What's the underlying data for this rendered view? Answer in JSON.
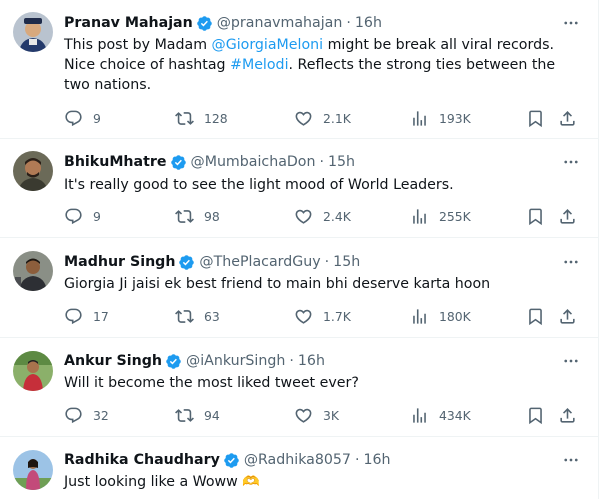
{
  "tweets": [
    {
      "name": "Pranav Mahajan",
      "verified": true,
      "handle": "@pranavmahajan",
      "time": "16h",
      "text_parts": [
        "This post by Madam ",
        "@GiorgiaMeloni",
        " might be break all viral records. Nice choice of hashtag ",
        "#Melodi",
        ". Reflects the strong ties between the two nations."
      ],
      "replies": "9",
      "retweets": "128",
      "likes": "2.1K",
      "views": "193K"
    },
    {
      "name": "BhikuMhatre",
      "verified": true,
      "handle": "@MumbaichaDon",
      "time": "15h",
      "text": "It's really good to see the light mood of World Leaders.",
      "replies": "9",
      "retweets": "98",
      "likes": "2.4K",
      "views": "255K"
    },
    {
      "name": "Madhur Singh",
      "verified": true,
      "handle": "@ThePlacardGuy",
      "time": "15h",
      "text": "Giorgia Ji jaisi ek best friend to main bhi deserve karta hoon",
      "replies": "17",
      "retweets": "63",
      "likes": "1.7K",
      "views": "180K"
    },
    {
      "name": "Ankur Singh",
      "verified": true,
      "handle": "@iAnkurSingh",
      "time": "16h",
      "text": "Will it become the most liked tweet ever?",
      "replies": "32",
      "retweets": "94",
      "likes": "3K",
      "views": "434K"
    },
    {
      "name": "Radhika Chaudhary",
      "verified": true,
      "handle": "@Radhika8057",
      "time": "16h",
      "text": "Just looking like a Woww",
      "emoji": "🫶"
    }
  ],
  "separator": "·",
  "icons": {
    "reply": "reply-icon",
    "retweet": "retweet-icon",
    "like": "heart-icon",
    "views": "views-icon",
    "bookmark": "bookmark-icon",
    "share": "share-icon",
    "more": "more-icon",
    "verified": "verified-badge-icon"
  },
  "colors": {
    "link": "#1d9bf0",
    "verified": "#1d9bf0",
    "secondary_text": "#536471",
    "primary_text": "#0f1419"
  }
}
